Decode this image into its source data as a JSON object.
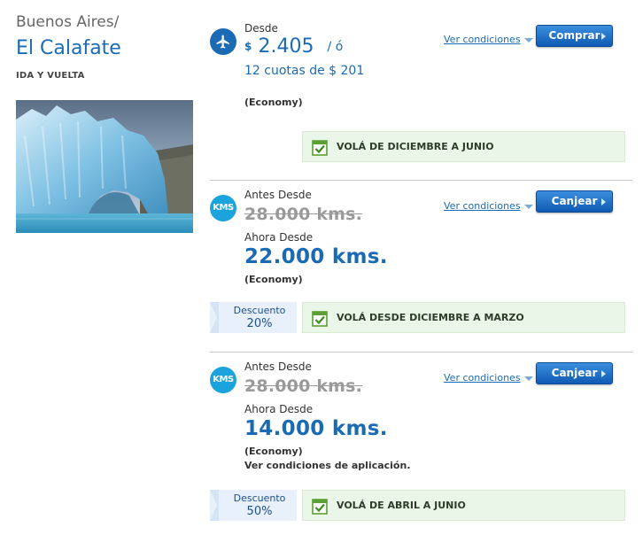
{
  "route": {
    "origin": "Buenos Aires/",
    "destination": "El Calafate",
    "trip_type": "IDA Y VUELTA"
  },
  "colors": {
    "brand_blue": "#1b6bb4",
    "kms_blue": "#1aa3dd",
    "promo_green_bg": "#eaf6e7",
    "check_green": "#5aa033"
  },
  "offers": [
    {
      "icon": "airplane-icon",
      "price_label": "Desde",
      "currency": "$",
      "price": "2.405",
      "price_suffix": "/ ó",
      "installments": "12 cuotas de $ 201",
      "cabin": "(Economy)",
      "conditions_link": "Ver condiciones",
      "button": "Comprar",
      "promo": "VOLÁ DE DICIEMBRE A JUNIO"
    },
    {
      "icon": "KMS",
      "before_label": "Antes Desde",
      "before_price": "28.000 kms.",
      "now_label": "Ahora Desde",
      "now_price": "22.000 kms.",
      "cabin": "(Economy)",
      "conditions_link": "Ver condiciones",
      "button": "Canjear",
      "discount_label": "Descuento",
      "discount_value": "20%",
      "promo": "VOLÁ DESDE DICIEMBRE A MARZO"
    },
    {
      "icon": "KMS",
      "before_label": "Antes Desde",
      "before_price": "28.000 kms.",
      "now_label": "Ahora Desde",
      "now_price": "14.000 kms.",
      "cabin": "(Economy)",
      "note": "Ver condiciones de aplicación.",
      "conditions_link": "Ver condiciones",
      "button": "Canjear",
      "discount_label": "Descuento",
      "discount_value": "50%",
      "promo": "VOLÁ DE ABRIL A JUNIO"
    }
  ]
}
